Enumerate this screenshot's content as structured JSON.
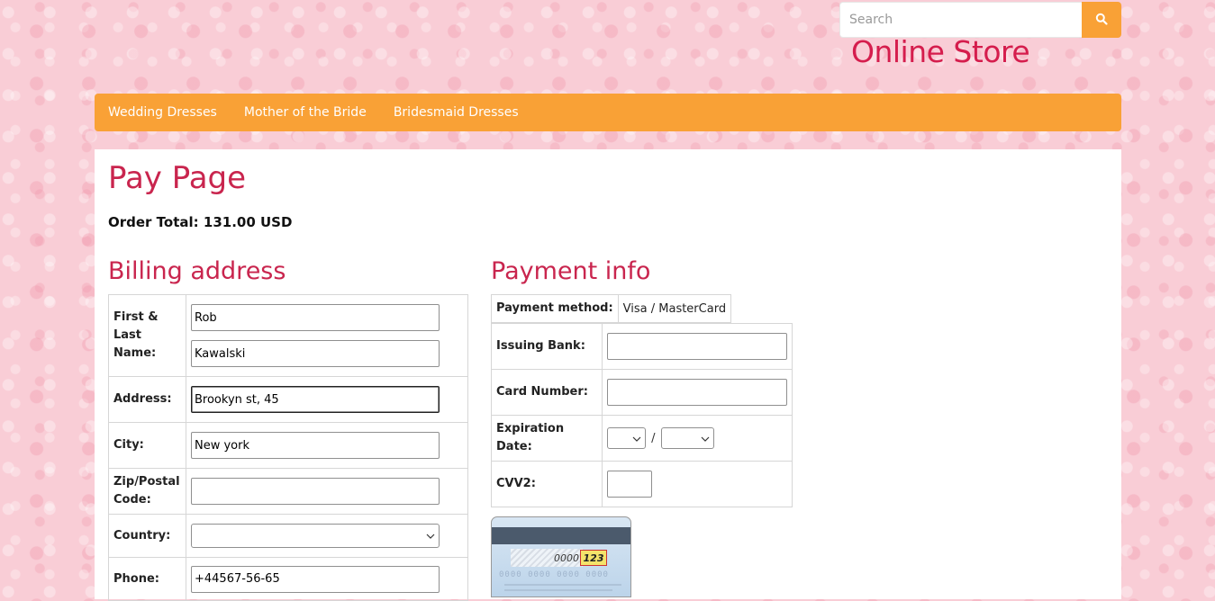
{
  "header": {
    "search_placeholder": "Search",
    "store_title": "Online Store",
    "icons": {
      "search": "search-icon"
    }
  },
  "nav": {
    "items": [
      {
        "label": "Wedding Dresses"
      },
      {
        "label": "Mother of the Bride"
      },
      {
        "label": "Bridesmaid Dresses"
      }
    ]
  },
  "page": {
    "title": "Pay Page",
    "order_total": "Order Total: 131.00 USD"
  },
  "billing": {
    "title": "Billing address",
    "name_label": "First & Last Name:",
    "first_name": "Rob",
    "last_name": "Kawalski",
    "address_label": "Address:",
    "address": "Brookyn st, 45",
    "city_label": "City:",
    "city": "New york",
    "zip_label": "Zip/Postal Code:",
    "zip": "",
    "country_label": "Country:",
    "country": "",
    "phone_label": "Phone:",
    "phone": "+44567-56-65"
  },
  "payment": {
    "title": "Payment info",
    "method_label": "Payment method:",
    "method_value": "Visa / MasterCard",
    "bank_label": "Issuing Bank:",
    "bank": "",
    "card_label": "Card Number:",
    "card": "",
    "exp_label": "Expiration Date:",
    "exp_separator": "/",
    "exp_month": "",
    "exp_year": "",
    "cvv_label": "CVV2:",
    "cvv": "",
    "card_image": {
      "sample_number": "0000",
      "sample_cvv": "123",
      "sample_digits": "0000 0000 0000 0000"
    }
  },
  "colors": {
    "accent": "#f9a136",
    "heading": "#c9254e",
    "background": "#f9cdd6"
  }
}
